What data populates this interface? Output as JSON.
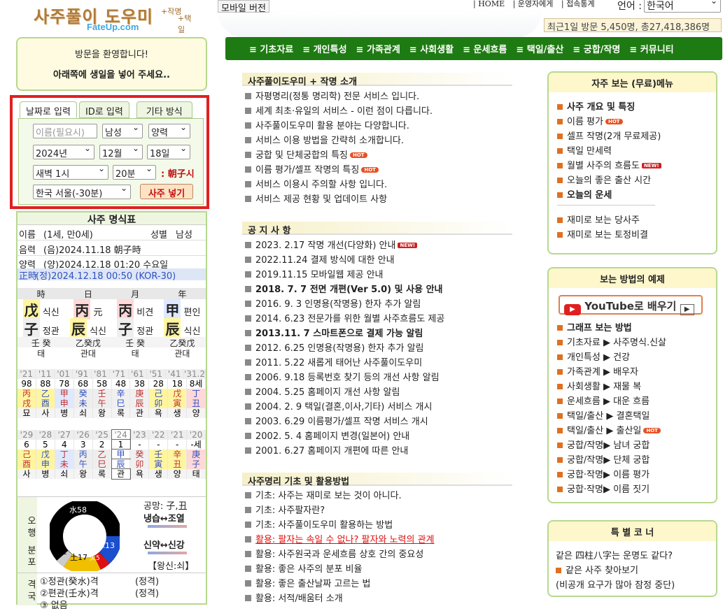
{
  "logo": {
    "title": "사주풀이 도우미",
    "sub1": "+작명",
    "sub2": "+택일",
    "url": "FateUp.com"
  },
  "header": {
    "mobile_label": "모바일 버전",
    "links": [
      "| HOME",
      "| 운영자에게",
      "| 접속통계"
    ],
    "lang_label": "언어 :",
    "lang_value": "한국어",
    "visits": "최근1일 방문 5,450명, 총27,418,386명"
  },
  "nav": [
    "≡ 기초자료",
    "≡ 개인특성",
    "≡ 가족관계",
    "≡ 사회생활",
    "≡ 운세흐름",
    "≡ 택일/출산",
    "≡ 궁합/작명",
    "≡ 커뮤니티"
  ],
  "welcome": {
    "line1": "방문을 환영합니다!",
    "line2": "아래쪽에 생일을 넣어 주세요.."
  },
  "input": {
    "tabs": [
      "날짜로 입력",
      "ID로 입력",
      "기타 방식"
    ],
    "name_placeholder": "이름(필요시)",
    "gender": "남성",
    "calendar": "양력",
    "year": "2024년",
    "month": "12월",
    "day": "18일",
    "hour": "새벽 1시",
    "minute": "20분",
    "hour_pillar": ": 朝子시",
    "location": "한국 서울(-30분)",
    "submit": "사주 넣기"
  },
  "saju": {
    "title": "사주 명식표",
    "name_label": "이름",
    "name_value": "(1세, 만0세)",
    "gender_label": "성별",
    "gender_value": "남성",
    "lunar_label": "음력",
    "lunar_value": "(음)2024.11.18 朝子時",
    "solar_label": "양력",
    "solar_value": "(양)2024.12.18 01:20 수요일",
    "correct_label": "正時",
    "correct_value": "(정)2024.12.18 00:50 (KOR-30)",
    "pillar_heads": [
      "時",
      "日",
      "月",
      "年"
    ],
    "stems": [
      [
        "戊",
        "식신"
      ],
      [
        "丙",
        "元"
      ],
      [
        "丙",
        "비견"
      ],
      [
        "甲",
        "편인"
      ]
    ],
    "branches": [
      [
        "子",
        "정관"
      ],
      [
        "辰",
        "식신"
      ],
      [
        "子",
        "정관"
      ],
      [
        "辰",
        "식신"
      ]
    ],
    "hidden": [
      "壬 癸",
      "乙癸戊",
      "壬 癸",
      "乙癸戊"
    ],
    "stages": [
      "태",
      "관대",
      "태",
      "관대"
    ],
    "daeun_years": [
      "'21",
      "'11",
      "'01",
      "'91",
      "'81",
      "'71",
      "'61",
      "'51",
      "'41",
      "'31.2월"
    ],
    "daeun_ages": [
      "98",
      "88",
      "78",
      "68",
      "58",
      "48",
      "38",
      "28",
      "18",
      "8세"
    ],
    "daeun_stems": [
      "丙",
      "乙",
      "甲",
      "癸",
      "壬",
      "辛",
      "庚",
      "己",
      "戊",
      "丁"
    ],
    "daeun_branches": [
      "戌",
      "酉",
      "申",
      "未",
      "午",
      "巳",
      "辰",
      "卯",
      "寅",
      "丑"
    ],
    "daeun_stages": [
      "묘",
      "사",
      "병",
      "쇠",
      "왕",
      "록",
      "관",
      "욕",
      "생",
      "양"
    ],
    "seun_years": [
      "'29",
      "'28",
      "'27",
      "'26",
      "'25",
      "'24",
      "'23",
      "'22",
      "'21",
      "'20년"
    ],
    "seun_ages": [
      "6",
      "5",
      "4",
      "3",
      "2",
      "1",
      "-",
      "-",
      "-",
      "-세"
    ],
    "seun_stems": [
      "己",
      "戊",
      "丁",
      "丙",
      "乙",
      "甲",
      "癸",
      "壬",
      "辛",
      "庚"
    ],
    "seun_branches": [
      "酉",
      "申",
      "未",
      "午",
      "巳",
      "辰",
      "卯",
      "寅",
      "丑",
      "子"
    ],
    "seun_stages": [
      "사",
      "병",
      "쇠",
      "왕",
      "록",
      "관",
      "욕",
      "생",
      "양",
      "태"
    ],
    "ohaeng_label": "오행 분포",
    "pie": {
      "water": "水58",
      "wood": "木13",
      "earth": "土17",
      "fire": "火5",
      "metal": "金2"
    },
    "gongmang": "공망: 子,丑",
    "cold": "냉습↔조열",
    "strength": "신약↔신강",
    "strength_sub": "【왕신:쇠】",
    "gyeok_label": "격국",
    "gyeok": [
      [
        "①정관(癸水)격",
        "(정격)"
      ],
      [
        "②편관(壬水)격",
        "(정격)"
      ],
      [
        "③ 없음",
        ""
      ]
    ]
  },
  "sections": {
    "intro_title": "사주풀이도우미 + 작명 소개",
    "intro": [
      "자평명리(정통 명리학) 전문 서비스 입니다.",
      "세계 최초·유일의 서비스 - 이런 점이 다릅니다.",
      "사주풀이도우미 활용 분야는 다양합니다.",
      "서비스 이용 방법을 간략히 소개합니다.",
      "궁합 및 단체궁합의 특징",
      "이름 평가/셀프 작명의 특징",
      "서비스 이용시 주의할 사항 입니다.",
      "서비스 제공 현황 및 업데이트 사항"
    ],
    "notice_title": "공 지 사 항",
    "notice": [
      "2023. 2.17 작명 개선(다양화) 안내",
      "2022.11.24 결제 방식에 대한 안내",
      "2019.11.15 모바일웹 제공 안내",
      "2018. 7. 7 전면 개편(Ver 5.0) 및 사용 안내",
      "2016. 9. 3 인명용(작명용) 한자 추가 알림",
      "2014. 6.23 전문가를 위한 월별 사주흐름도 제공",
      "2013.11. 7 스마트폰으로 결제 가능 알림",
      "2012. 6.25 인명용(작명용) 한자 추가 알림",
      "2011. 5.22 새롭게 태어난 사주풀이도우미",
      "2006. 9.18 등록번호 찾기 등의 개선 사항 알림",
      "2004. 5.25 홈페이지 개선 사항 알림",
      "2004. 2. 9 택일(결혼,이사,기타) 서비스 개시",
      "2003. 6.29 이름평가/셀프 작명 서비스 개시",
      "2002. 5. 4 홈페이지 변경(일본어) 안내",
      "2001. 6.27 홈페이지 개편에 따른 안내"
    ],
    "basics_title": "사주명리 기초 및 활용방법",
    "basics": [
      "기초: 사주는 재미로 보는 것이 아니다.",
      "기초: 사주팔자란?",
      "기초: 사주풀이도우미 활용하는 방법",
      "활용: 팔자는 속일 수 없나? 팔자와 노력의 관계",
      "활용: 사주원국과 운세흐름 상호 간의 중요성",
      "활용: 좋은 사주의 분포 비율",
      "활용: 좋은 출산날짜 고르는 법",
      "활용: 서적/배움터 소개"
    ]
  },
  "right": {
    "free_title": "자주 보는 (무료)메뉴",
    "free": [
      "사주 개요 및 특징",
      "이름 평가",
      "셀프 작명(2개 무료제공)",
      "택일 만세력",
      "월별 사주의 흐름도",
      "오늘의 좋은 출산 시간",
      "오늘의 운세"
    ],
    "fun": [
      "재미로 보는 당사주",
      "재미로 보는 토정비결"
    ],
    "how_title": "보는 방법의 예제",
    "youtube_label": "YouTube로 배우기",
    "how": [
      "그래프 보는 방법",
      "기초자료 ▶ 사주명식.신살",
      "개인특성 ▶ 건강",
      "가족관계 ▶ 배우자",
      "사회생활 ▶ 재물 복",
      "운세흐름 ▶ 대운 흐름",
      "택일/출산 ▶ 결혼택일",
      "택일/출산 ▶ 출산일",
      "궁합/작명▶ 남녀 궁합",
      "궁합/작명▶ 단체 궁합",
      "궁합·작명▶ 이름 평가",
      "궁합·작명▶ 이름 짓기"
    ],
    "special_title": "특 별 코 너",
    "special_q": "같은 四柱八字는 운명도 같다?",
    "special_item": "같은 사주 찾아보기",
    "special_note": "(비공개 요구가 많아 잠정 중단)"
  },
  "badges": {
    "hot": "HOT",
    "new": "NEW!"
  },
  "colors": {
    "nav_green": "#1e7a12",
    "panel_border": "#b7d88f",
    "highlight_red": "#e02020",
    "water": "#000000",
    "wood": "#1a4fd0",
    "fire": "#e01010",
    "earth": "#f0c000",
    "metal": "#cccccc"
  }
}
